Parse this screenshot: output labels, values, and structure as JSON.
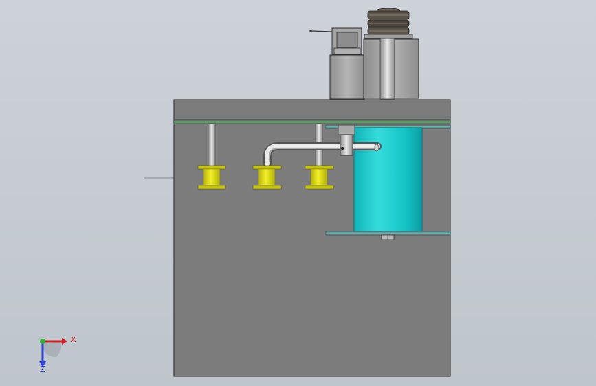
{
  "viewport": {
    "background_colors": [
      "#cdd2d8",
      "#bfc5cc"
    ]
  },
  "model": {
    "colors": {
      "housing": "#7c7c7c",
      "housing_edge": "#3a3a3a",
      "rail": "#6dbb78",
      "tank": "#16c4c6",
      "tank_highlight": "#6ee6e6",
      "coil": "#e3e000",
      "motor": "#9a9a9a",
      "pulley": "#5c534a"
    }
  },
  "triad": {
    "x_label": "X",
    "z_label": "Z",
    "x_color": "#d42020",
    "y_color": "#2fb32f",
    "z_color": "#2a3fd8"
  }
}
